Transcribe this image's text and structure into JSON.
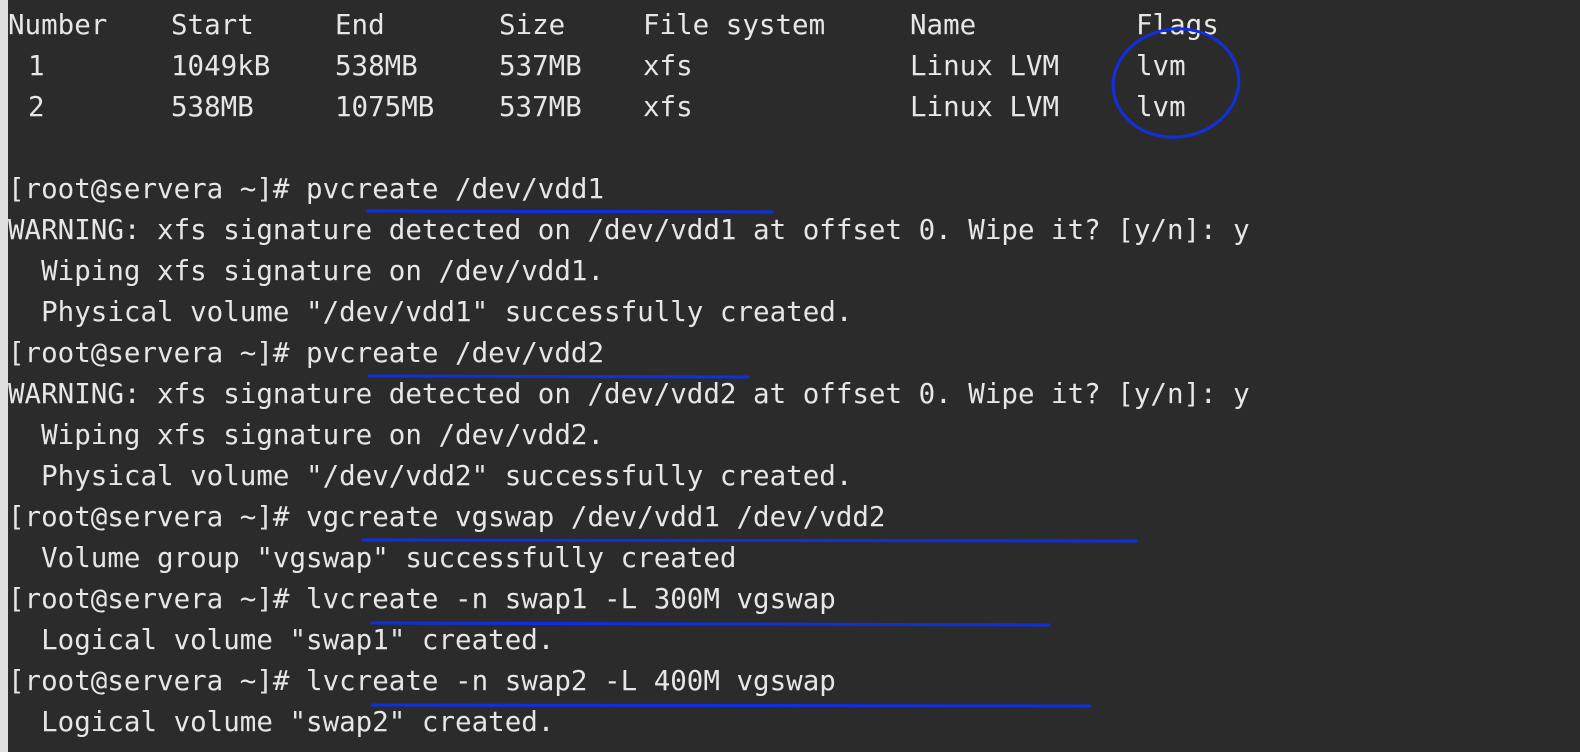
{
  "partition_table": {
    "headers": [
      "Number",
      "Start",
      "End",
      "Size",
      "File system",
      "Name",
      "Flags"
    ],
    "rows": [
      [
        "1",
        "1049kB",
        "538MB",
        "537MB",
        "xfs",
        "Linux LVM",
        "lvm"
      ],
      [
        "2",
        "538MB",
        "1075MB",
        "537MB",
        "xfs",
        "Linux LVM",
        "lvm"
      ]
    ]
  },
  "output_lines": [
    "[root@servera ~]# pvcreate /dev/vdd1",
    "WARNING: xfs signature detected on /dev/vdd1 at offset 0. Wipe it? [y/n]: y",
    "  Wiping xfs signature on /dev/vdd1.",
    "  Physical volume \"/dev/vdd1\" successfully created.",
    "[root@servera ~]# pvcreate /dev/vdd2",
    "WARNING: xfs signature detected on /dev/vdd2 at offset 0. Wipe it? [y/n]: y",
    "  Wiping xfs signature on /dev/vdd2.",
    "  Physical volume \"/dev/vdd2\" successfully created.",
    "[root@servera ~]# vgcreate vgswap /dev/vdd1 /dev/vdd2",
    "  Volume group \"vgswap\" successfully created",
    "[root@servera ~]# lvcreate -n swap1 -L 300M vgswap",
    "  Logical volume \"swap1\" created.",
    "[root@servera ~]# lvcreate -n swap2 -L 400M vgswap",
    "  Logical volume \"swap2\" created."
  ],
  "colors": {
    "terminal_background": "#2b2b2b",
    "terminal_text": "#e6e6e6",
    "annotation": "#1030e0",
    "left_margin": "#dedede"
  }
}
